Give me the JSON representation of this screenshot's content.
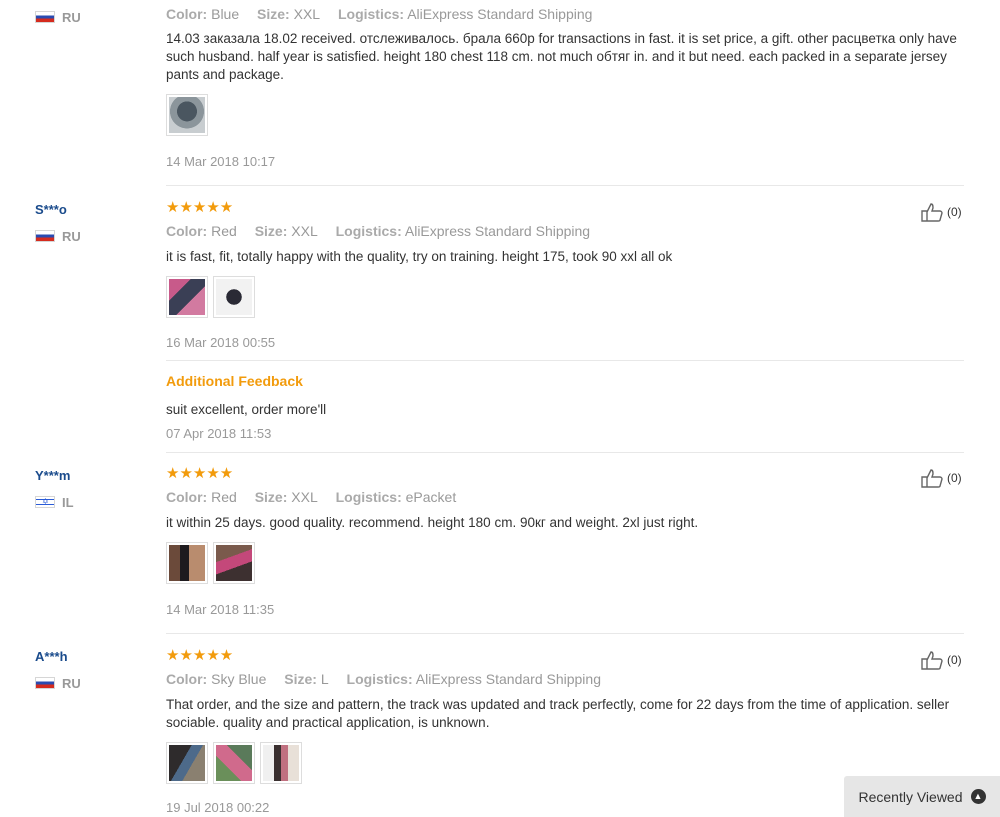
{
  "reviews": [
    {
      "user": "",
      "country": "RU",
      "color_label": "Color:",
      "color": "Blue",
      "size_label": "Size:",
      "size": "XXL",
      "logistics_label": "Logistics:",
      "logistics": "AliExpress Standard Shipping",
      "text": "14.03 заказала 18.02 received. отслеживалось. брала 660р for transactions in fast. it is set price, a gift. other расцветка only have such husband. half year is satisfied. height 180 chest 118 cm. not much обтяг in. and it but need. each packed in a separate jersey pants and package.",
      "date": "14 Mar 2018 10:17"
    },
    {
      "user": "S***o",
      "country": "RU",
      "stars": "★★★★★",
      "color_label": "Color:",
      "color": "Red",
      "size_label": "Size:",
      "size": "XXL",
      "logistics_label": "Logistics:",
      "logistics": "AliExpress Standard Shipping",
      "text": "it is fast, fit, totally happy with the quality, try on training. height 175, took 90 xxl all ok",
      "date": "16 Mar 2018 00:55",
      "likes": "(0)",
      "additional_title": "Additional Feedback",
      "additional_text": "suit excellent, order more'll",
      "additional_date": "07 Apr 2018 11:53"
    },
    {
      "user": "Y***m",
      "country": "IL",
      "stars": "★★★★★",
      "color_label": "Color:",
      "color": "Red",
      "size_label": "Size:",
      "size": "XXL",
      "logistics_label": "Logistics:",
      "logistics": "ePacket",
      "text": "it within 25 days. good quality. recommend. height 180 cm. 90кг and weight. 2xl just right.",
      "date": "14 Mar 2018 11:35",
      "likes": "(0)"
    },
    {
      "user": "A***h",
      "country": "RU",
      "stars": "★★★★★",
      "color_label": "Color:",
      "color": "Sky Blue",
      "size_label": "Size:",
      "size": "L",
      "logistics_label": "Logistics:",
      "logistics": "AliExpress Standard Shipping",
      "text": "That order, and the size and pattern, the track was updated and track perfectly, come for 22 days from the time of application. seller sociable. quality and practical application, is unknown.",
      "date": "19 Jul 2018 00:22",
      "likes": "(0)"
    }
  ],
  "recently_viewed": "Recently Viewed",
  "colors": {
    "star": "#f29b0c",
    "username": "#1a4b8c",
    "muted": "#999999"
  },
  "icons": {
    "like": "thumbs-up-icon",
    "recent": "chevron-up-icon"
  }
}
